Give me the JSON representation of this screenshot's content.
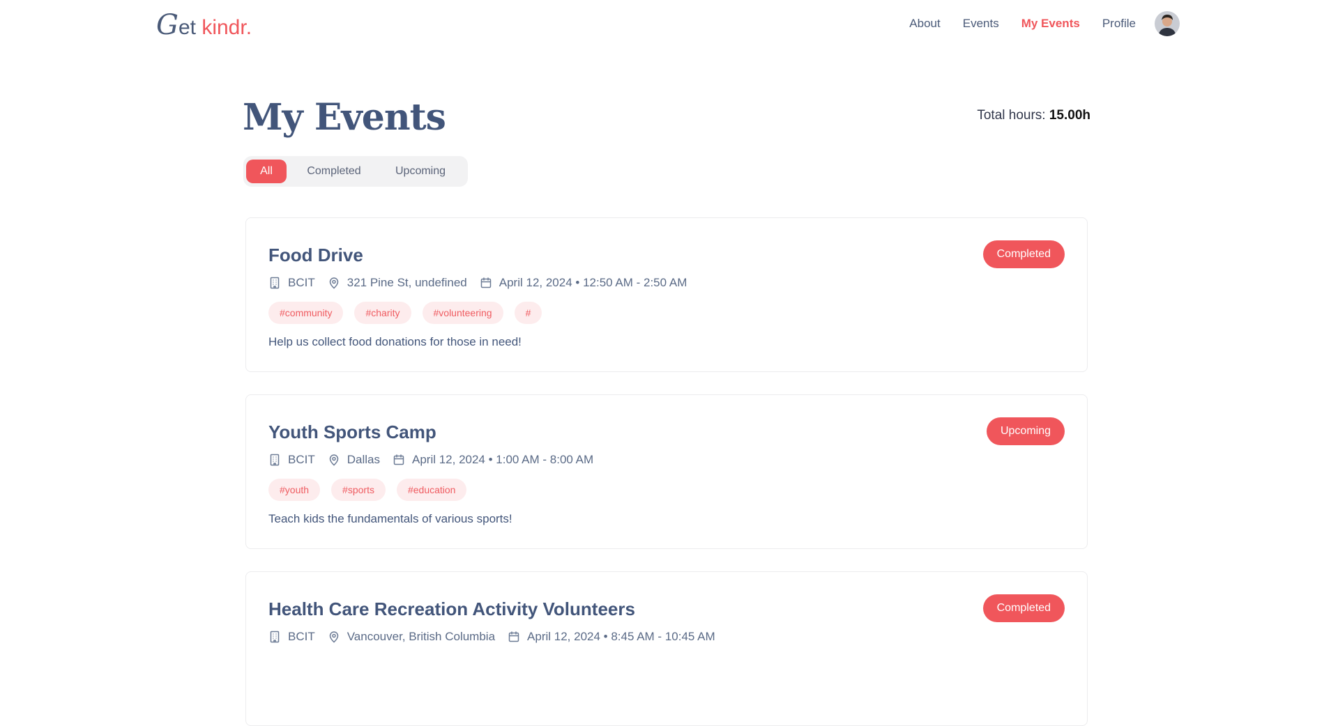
{
  "nav": {
    "logo_g": "G",
    "logo_et": "et",
    "logo_kindr": "kindr.",
    "links": [
      "About",
      "Events",
      "My Events",
      "Profile"
    ],
    "active_link": "My Events"
  },
  "header": {
    "title": "My Events",
    "total_label": "Total hours: ",
    "total_value": "15.00h"
  },
  "filters": [
    "All",
    "Completed",
    "Upcoming"
  ],
  "active_filter": "All",
  "events": [
    {
      "title": "Food Drive",
      "status": "Completed",
      "organization": "BCIT",
      "location": "321 Pine St, undefined",
      "datetime": "April 12, 2024 • 12:50 AM - 2:50 AM",
      "tags": [
        "#community",
        "#charity",
        "#volunteering",
        "#"
      ],
      "description": "Help us collect food donations for those in need!"
    },
    {
      "title": "Youth Sports Camp",
      "status": "Upcoming",
      "organization": "BCIT",
      "location": "Dallas",
      "datetime": "April 12, 2024 • 1:00 AM - 8:00 AM",
      "tags": [
        "#youth",
        "#sports",
        "#education"
      ],
      "description": "Teach kids the fundamentals of various sports!"
    },
    {
      "title": "Health Care Recreation Activity Volunteers",
      "status": "Completed",
      "organization": "BCIT",
      "location": "Vancouver, British Columbia",
      "datetime": "April 12, 2024 • 8:45 AM - 10:45 AM",
      "tags": [],
      "description": ""
    }
  ],
  "colors": {
    "accent": "#f0565b",
    "text": "#42557a",
    "tag_bg": "#fdeced"
  }
}
